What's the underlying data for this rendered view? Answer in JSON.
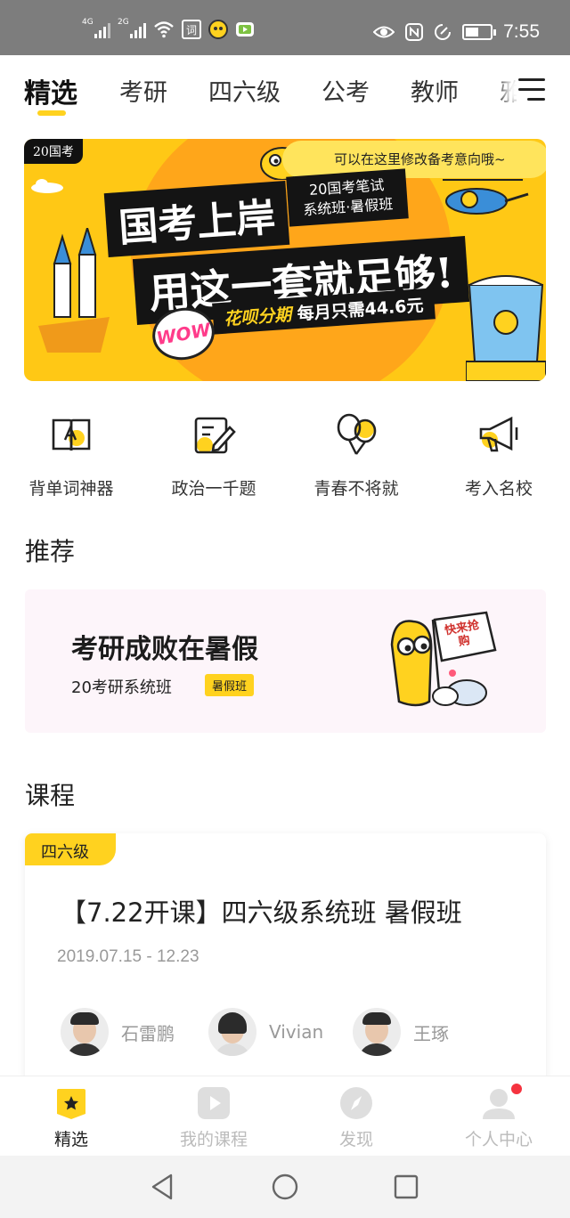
{
  "status_bar": {
    "signal1_label": "4G",
    "signal2_label": "2G",
    "app_icon1": "词",
    "time": "7:55",
    "battery_level": 0.55
  },
  "top_tabs": [
    {
      "label": "精选",
      "active": true
    },
    {
      "label": "考研",
      "active": false
    },
    {
      "label": "四六级",
      "active": false
    },
    {
      "label": "公考",
      "active": false
    },
    {
      "label": "教师",
      "active": false
    },
    {
      "label": "雅",
      "active": false
    }
  ],
  "banner": {
    "tag": "20国考",
    "hint": "可以在这里修改备考意向哦~",
    "headline1": "国考上岸",
    "headline2": "用这一套就足够!",
    "sub_line1": "20国考笔试",
    "sub_line2": "系统班·暑假班",
    "promo_highlight": "花呗分期",
    "promo_text": "每月只需44.6元",
    "sticker": "WOW"
  },
  "quick_entries": [
    {
      "label": "背单词神器",
      "icon": "open-book-icon"
    },
    {
      "label": "政治一千题",
      "icon": "notepad-pen-icon"
    },
    {
      "label": "青春不将就",
      "icon": "balloons-icon"
    },
    {
      "label": "考入名校",
      "icon": "megaphone-icon"
    }
  ],
  "sections": {
    "recommend_title": "推荐",
    "courses_title": "课程"
  },
  "promo_card": {
    "title": "考研成败在暑假",
    "subtitle": "20考研系统班",
    "badge": "暑假班",
    "flag_text": "快来抢购"
  },
  "course": {
    "tag": "四六级",
    "title": "【7.22开课】四六级系统班 暑假班",
    "date": "2019.07.15 - 12.23",
    "teachers": [
      "石雷鹏",
      "Vivian",
      "王琢"
    ]
  },
  "bottom_nav": [
    {
      "label": "精选",
      "icon": "star-bookmark-icon",
      "active": true
    },
    {
      "label": "我的课程",
      "icon": "play-icon",
      "active": false
    },
    {
      "label": "发现",
      "icon": "compass-icon",
      "active": false
    },
    {
      "label": "个人中心",
      "icon": "user-icon",
      "active": false,
      "has_badge": true
    }
  ],
  "colors": {
    "accent": "#ffd21f",
    "banner_bg": "#ffc815",
    "badge_red": "#f5333f",
    "inactive_gray": "#bbbbbb"
  }
}
